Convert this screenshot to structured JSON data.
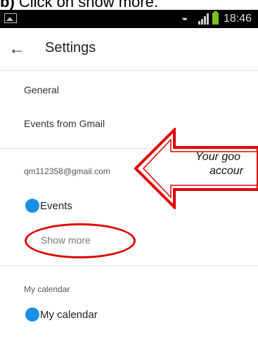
{
  "caption": {
    "prefix": "b)",
    "text": "Click on show more."
  },
  "status_bar": {
    "time": "18:46",
    "wifi_icon": "wifi-icon",
    "signal_icon": "signal-icon",
    "battery_icon": "battery-charging-icon",
    "gallery_icon": "image-icon"
  },
  "app_bar": {
    "title": "Settings",
    "back_icon": "arrow-back-icon"
  },
  "items": {
    "general": "General",
    "events_from_gmail": "Events from Gmail"
  },
  "account": {
    "email": "qm112358@gmail.com",
    "calendar_label": "Events",
    "calendar_color": "#1a8fe3",
    "show_more": "Show more"
  },
  "my_calendar": {
    "section": "My calendar",
    "calendar_label": "My calendar",
    "calendar_color": "#1a8fe3"
  },
  "callout": {
    "line1": "Your goo",
    "line2": "accour",
    "color": "#e00000"
  }
}
